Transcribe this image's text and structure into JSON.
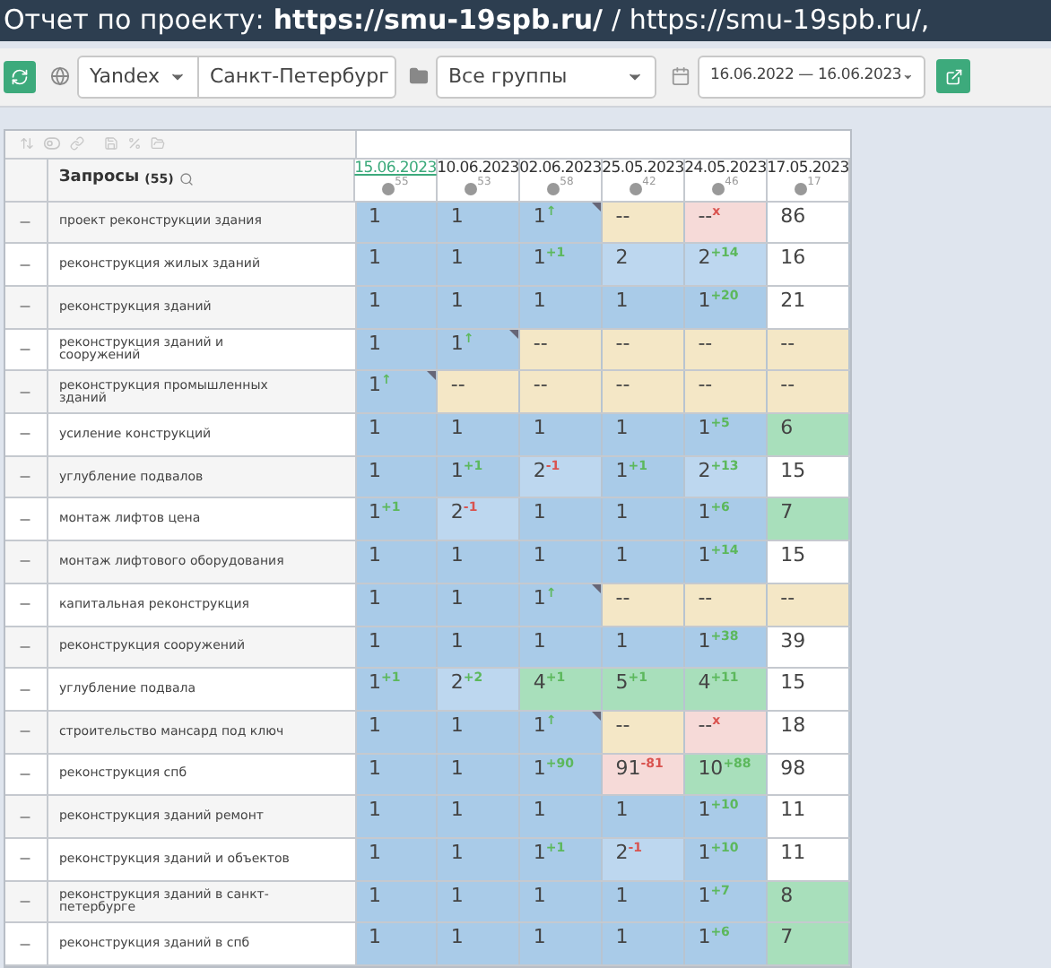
{
  "title": {
    "label": "Отчет по проекту:",
    "project": "https://smu-19spb.ru/",
    "rest": "/ https://smu-19spb.ru/,"
  },
  "toolbar": {
    "engine": "Yandex",
    "region": "Санкт-Петербург",
    "group": "Все группы",
    "period": "16.06.2022 — 16.06.2023"
  },
  "table": {
    "query_header": "Запросы",
    "query_count": "(55)",
    "dates": [
      {
        "label": "15.06.2023",
        "count": "55",
        "selected": true
      },
      {
        "label": "10.06.2023",
        "count": "53",
        "selected": false
      },
      {
        "label": "02.06.2023",
        "count": "58",
        "selected": false
      },
      {
        "label": "25.05.2023",
        "count": "42",
        "selected": false
      },
      {
        "label": "24.05.2023",
        "count": "46",
        "selected": false
      },
      {
        "label": "17.05.2023",
        "count": "17",
        "selected": false
      }
    ],
    "rows": [
      {
        "query": "проект реконструкции здания",
        "cells": [
          {
            "value": "1",
            "kind": "top",
            "flag": false
          },
          {
            "value": "1",
            "kind": "top",
            "flag": false
          },
          {
            "value": "1",
            "delta": "↑",
            "color": "#5cb85c",
            "kind": "top",
            "flag": true
          },
          {
            "value": "--",
            "kind": "none",
            "flag": false
          },
          {
            "value": "--",
            "delta": "x",
            "color": "#d9534f",
            "kind": "lost",
            "flag": false
          },
          {
            "value": "86",
            "kind": "plain",
            "flag": false
          }
        ]
      },
      {
        "query": "реконструкция жилых зданий",
        "cells": [
          {
            "value": "1",
            "kind": "top",
            "flag": false
          },
          {
            "value": "1",
            "kind": "top",
            "flag": false
          },
          {
            "value": "1",
            "delta": "+1",
            "color": "#5cb85c",
            "kind": "top",
            "flag": false
          },
          {
            "value": "2",
            "kind": "top3",
            "flag": false
          },
          {
            "value": "2",
            "delta": "+14",
            "color": "#5cb85c",
            "kind": "top3",
            "flag": false
          },
          {
            "value": "16",
            "kind": "plain",
            "flag": false
          }
        ]
      },
      {
        "query": "реконструкция зданий",
        "cells": [
          {
            "value": "1",
            "kind": "top",
            "flag": false
          },
          {
            "value": "1",
            "kind": "top",
            "flag": false
          },
          {
            "value": "1",
            "kind": "top",
            "flag": false
          },
          {
            "value": "1",
            "kind": "top",
            "flag": false
          },
          {
            "value": "1",
            "delta": "+20",
            "color": "#5cb85c",
            "kind": "top",
            "flag": false
          },
          {
            "value": "21",
            "kind": "plain",
            "flag": false
          }
        ]
      },
      {
        "query": "реконструкция зданий и сооружений",
        "cells": [
          {
            "value": "1",
            "kind": "top",
            "flag": false
          },
          {
            "value": "1",
            "delta": "↑",
            "color": "#5cb85c",
            "kind": "top",
            "flag": true
          },
          {
            "value": "--",
            "kind": "none",
            "flag": false
          },
          {
            "value": "--",
            "kind": "none",
            "flag": false
          },
          {
            "value": "--",
            "kind": "none",
            "flag": false
          },
          {
            "value": "--",
            "kind": "none",
            "flag": false
          }
        ]
      },
      {
        "query": "реконструкция промышленных зданий",
        "cells": [
          {
            "value": "1",
            "delta": "↑",
            "color": "#5cb85c",
            "kind": "top",
            "flag": true
          },
          {
            "value": "--",
            "kind": "none",
            "flag": false
          },
          {
            "value": "--",
            "kind": "none",
            "flag": false
          },
          {
            "value": "--",
            "kind": "none",
            "flag": false
          },
          {
            "value": "--",
            "kind": "none",
            "flag": false
          },
          {
            "value": "--",
            "kind": "none",
            "flag": false
          }
        ]
      },
      {
        "query": "усиление конструкций",
        "cells": [
          {
            "value": "1",
            "kind": "top",
            "flag": false
          },
          {
            "value": "1",
            "kind": "top",
            "flag": false
          },
          {
            "value": "1",
            "kind": "top",
            "flag": false
          },
          {
            "value": "1",
            "kind": "top",
            "flag": false
          },
          {
            "value": "1",
            "delta": "+5",
            "color": "#5cb85c",
            "kind": "top",
            "flag": false
          },
          {
            "value": "6",
            "kind": "top10",
            "flag": false
          }
        ]
      },
      {
        "query": "углубление подвалов",
        "cells": [
          {
            "value": "1",
            "kind": "top",
            "flag": false
          },
          {
            "value": "1",
            "delta": "+1",
            "color": "#5cb85c",
            "kind": "top",
            "flag": false
          },
          {
            "value": "2",
            "delta": "-1",
            "color": "#d9534f",
            "kind": "top3",
            "flag": false
          },
          {
            "value": "1",
            "delta": "+1",
            "color": "#5cb85c",
            "kind": "top",
            "flag": false
          },
          {
            "value": "2",
            "delta": "+13",
            "color": "#5cb85c",
            "kind": "top3",
            "flag": false
          },
          {
            "value": "15",
            "kind": "plain",
            "flag": false
          }
        ]
      },
      {
        "query": "монтаж лифтов цена",
        "cells": [
          {
            "value": "1",
            "delta": "+1",
            "color": "#5cb85c",
            "kind": "top",
            "flag": false
          },
          {
            "value": "2",
            "delta": "-1",
            "color": "#d9534f",
            "kind": "top3",
            "flag": false
          },
          {
            "value": "1",
            "kind": "top",
            "flag": false
          },
          {
            "value": "1",
            "kind": "top",
            "flag": false
          },
          {
            "value": "1",
            "delta": "+6",
            "color": "#5cb85c",
            "kind": "top",
            "flag": false
          },
          {
            "value": "7",
            "kind": "top10",
            "flag": false
          }
        ]
      },
      {
        "query": "монтаж лифтового оборудования",
        "cells": [
          {
            "value": "1",
            "kind": "top",
            "flag": false
          },
          {
            "value": "1",
            "kind": "top",
            "flag": false
          },
          {
            "value": "1",
            "kind": "top",
            "flag": false
          },
          {
            "value": "1",
            "kind": "top",
            "flag": false
          },
          {
            "value": "1",
            "delta": "+14",
            "color": "#5cb85c",
            "kind": "top",
            "flag": false
          },
          {
            "value": "15",
            "kind": "plain",
            "flag": false
          }
        ]
      },
      {
        "query": "капитальная реконструкция",
        "cells": [
          {
            "value": "1",
            "kind": "top",
            "flag": false
          },
          {
            "value": "1",
            "kind": "top",
            "flag": false
          },
          {
            "value": "1",
            "delta": "↑",
            "color": "#5cb85c",
            "kind": "top",
            "flag": true
          },
          {
            "value": "--",
            "kind": "none",
            "flag": false
          },
          {
            "value": "--",
            "kind": "none",
            "flag": false
          },
          {
            "value": "--",
            "kind": "none",
            "flag": false
          }
        ]
      },
      {
        "query": "реконструкция сооружений",
        "cells": [
          {
            "value": "1",
            "kind": "top",
            "flag": false
          },
          {
            "value": "1",
            "kind": "top",
            "flag": false
          },
          {
            "value": "1",
            "kind": "top",
            "flag": false
          },
          {
            "value": "1",
            "kind": "top",
            "flag": false
          },
          {
            "value": "1",
            "delta": "+38",
            "color": "#5cb85c",
            "kind": "top",
            "flag": false
          },
          {
            "value": "39",
            "kind": "plain",
            "flag": false
          }
        ]
      },
      {
        "query": "углубление подвала",
        "cells": [
          {
            "value": "1",
            "delta": "+1",
            "color": "#5cb85c",
            "kind": "top",
            "flag": false
          },
          {
            "value": "2",
            "delta": "+2",
            "color": "#5cb85c",
            "kind": "top3",
            "flag": false
          },
          {
            "value": "4",
            "delta": "+1",
            "color": "#5cb85c",
            "kind": "top10",
            "flag": false
          },
          {
            "value": "5",
            "delta": "+1",
            "color": "#5cb85c",
            "kind": "top10",
            "flag": false
          },
          {
            "value": "4",
            "delta": "+11",
            "color": "#5cb85c",
            "kind": "top10",
            "flag": false
          },
          {
            "value": "15",
            "kind": "plain",
            "flag": false
          }
        ]
      },
      {
        "query": "строительство мансард под ключ",
        "cells": [
          {
            "value": "1",
            "kind": "top",
            "flag": false
          },
          {
            "value": "1",
            "kind": "top",
            "flag": false
          },
          {
            "value": "1",
            "delta": "↑",
            "color": "#5cb85c",
            "kind": "top",
            "flag": true
          },
          {
            "value": "--",
            "kind": "none",
            "flag": false
          },
          {
            "value": "--",
            "delta": "x",
            "color": "#d9534f",
            "kind": "lost",
            "flag": false
          },
          {
            "value": "18",
            "kind": "plain",
            "flag": false
          }
        ]
      },
      {
        "query": "реконструкция спб",
        "cells": [
          {
            "value": "1",
            "kind": "top",
            "flag": false
          },
          {
            "value": "1",
            "kind": "top",
            "flag": false
          },
          {
            "value": "1",
            "delta": "+90",
            "color": "#5cb85c",
            "kind": "top",
            "flag": false
          },
          {
            "value": "91",
            "delta": "-81",
            "color": "#d9534f",
            "kind": "lost",
            "flag": false
          },
          {
            "value": "10",
            "delta": "+88",
            "color": "#5cb85c",
            "kind": "top10",
            "flag": false
          },
          {
            "value": "98",
            "kind": "plain",
            "flag": false
          }
        ]
      },
      {
        "query": "реконструкция зданий ремонт",
        "cells": [
          {
            "value": "1",
            "kind": "top",
            "flag": false
          },
          {
            "value": "1",
            "kind": "top",
            "flag": false
          },
          {
            "value": "1",
            "kind": "top",
            "flag": false
          },
          {
            "value": "1",
            "kind": "top",
            "flag": false
          },
          {
            "value": "1",
            "delta": "+10",
            "color": "#5cb85c",
            "kind": "top",
            "flag": false
          },
          {
            "value": "11",
            "kind": "plain",
            "flag": false
          }
        ]
      },
      {
        "query": "реконструкция зданий и объектов",
        "cells": [
          {
            "value": "1",
            "kind": "top",
            "flag": false
          },
          {
            "value": "1",
            "kind": "top",
            "flag": false
          },
          {
            "value": "1",
            "delta": "+1",
            "color": "#5cb85c",
            "kind": "top",
            "flag": false
          },
          {
            "value": "2",
            "delta": "-1",
            "color": "#d9534f",
            "kind": "top3",
            "flag": false
          },
          {
            "value": "1",
            "delta": "+10",
            "color": "#5cb85c",
            "kind": "top",
            "flag": false
          },
          {
            "value": "11",
            "kind": "plain",
            "flag": false
          }
        ]
      },
      {
        "query": "реконструкция зданий в санкт-петербурге",
        "cells": [
          {
            "value": "1",
            "kind": "top",
            "flag": false
          },
          {
            "value": "1",
            "kind": "top",
            "flag": false
          },
          {
            "value": "1",
            "kind": "top",
            "flag": false
          },
          {
            "value": "1",
            "kind": "top",
            "flag": false
          },
          {
            "value": "1",
            "delta": "+7",
            "color": "#5cb85c",
            "kind": "top",
            "flag": false
          },
          {
            "value": "8",
            "kind": "top10",
            "flag": false
          }
        ]
      },
      {
        "query": "реконструкция зданий в спб",
        "cells": [
          {
            "value": "1",
            "kind": "top",
            "flag": false
          },
          {
            "value": "1",
            "kind": "top",
            "flag": false
          },
          {
            "value": "1",
            "kind": "top",
            "flag": false
          },
          {
            "value": "1",
            "kind": "top",
            "flag": false
          },
          {
            "value": "1",
            "delta": "+6",
            "color": "#5cb85c",
            "kind": "top",
            "flag": false
          },
          {
            "value": "7",
            "kind": "top10",
            "flag": false
          }
        ]
      }
    ]
  }
}
